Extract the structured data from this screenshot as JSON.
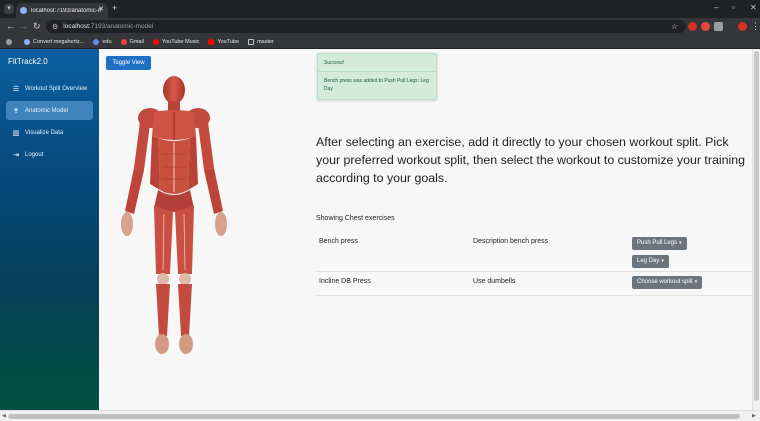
{
  "browser": {
    "tab_title": "localhost:7193/anatomic-model",
    "url_host": "localhost:",
    "url_path": "7193/anatomic-model",
    "bookmarks": [
      {
        "label": "Convert megahertz...",
        "icon": "convert-icon",
        "color": "#8ab4f8"
      },
      {
        "label": "edu",
        "icon": "edu-icon",
        "color": "#5b8def"
      },
      {
        "label": "Gmail",
        "icon": "gmail-icon",
        "color": "#ea4335"
      },
      {
        "label": "YouTube Music",
        "icon": "youtube-music-icon",
        "color": "#ff0000"
      },
      {
        "label": "YouTube",
        "icon": "youtube-icon",
        "color": "#ff0000"
      },
      {
        "label": "master",
        "icon": "folder-icon",
        "color": "#c8c8c8"
      }
    ]
  },
  "sidebar": {
    "brand": "FitTrack2.0",
    "items": [
      {
        "label": "Workout Split Overview",
        "icon": "list-icon",
        "active": false
      },
      {
        "label": "Anatomic Model",
        "icon": "person-icon",
        "active": true
      },
      {
        "label": "Visualize Data",
        "icon": "bar-icon",
        "active": false
      },
      {
        "label": "Logout",
        "icon": "logout-icon",
        "active": false
      }
    ]
  },
  "main": {
    "toggle_label": "Toggle View",
    "alert": {
      "title": "Success!",
      "message": "Bench press was added to Push Pull Legs: Leg Day"
    },
    "intro": "After selecting an exercise, add it directly to your chosen workout split. Pick your preferred workout split, then select the workout to customize your training according to your goals.",
    "showing": "Showing Chest exercises",
    "exercises": [
      {
        "name": "Bench press",
        "description": "Description bench press",
        "dropdowns": [
          "Push Pull Legs",
          "Leg Day"
        ]
      },
      {
        "name": "Incline DB Press",
        "description": "Use dumbells",
        "dropdowns": [
          "Choose workout split"
        ]
      }
    ]
  },
  "colors": {
    "accent": "#1f6fc4",
    "sidebar_active": "#3f84bd",
    "alert_bg": "#d3ebdc",
    "dropdown_bg": "#6c757d"
  }
}
